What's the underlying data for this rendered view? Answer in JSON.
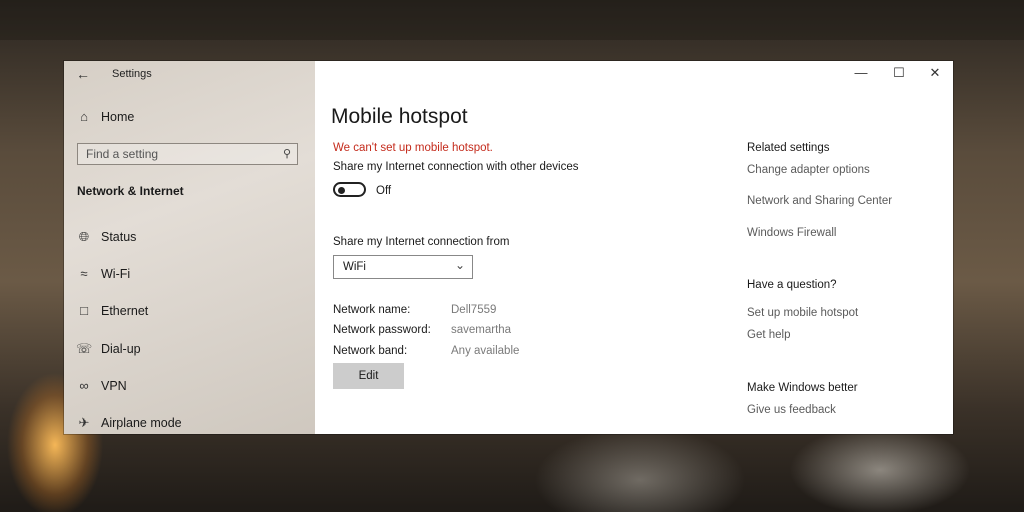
{
  "window": {
    "title": "Settings",
    "controls": {
      "minimize": "—",
      "maximize": "☐",
      "close": "✕"
    }
  },
  "sidebar": {
    "home_label": "Home",
    "search_placeholder": "Find a setting",
    "section_title": "Network & Internet",
    "items": [
      {
        "label": "Status",
        "icon": "globe-icon"
      },
      {
        "label": "Wi-Fi",
        "icon": "wifi-icon"
      },
      {
        "label": "Ethernet",
        "icon": "ethernet-icon"
      },
      {
        "label": "Dial-up",
        "icon": "phone-icon"
      },
      {
        "label": "VPN",
        "icon": "vpn-icon"
      },
      {
        "label": "Airplane mode",
        "icon": "airplane-icon"
      }
    ]
  },
  "main": {
    "title": "Mobile hotspot",
    "error": "We can't set up mobile hotspot.",
    "share_label": "Share my Internet connection with other devices",
    "toggle_state": "Off",
    "share_from_label": "Share my Internet connection from",
    "share_from_value": "WiFi",
    "network": {
      "name_label": "Network name:",
      "name_value": "Dell7559",
      "password_label": "Network password:",
      "password_value": "savemartha",
      "band_label": "Network band:",
      "band_value": "Any available"
    },
    "edit_label": "Edit"
  },
  "related": {
    "heading": "Related settings",
    "links": [
      "Change adapter options",
      "Network and Sharing Center",
      "Windows Firewall"
    ],
    "question_heading": "Have a question?",
    "question_links": [
      "Set up mobile hotspot",
      "Get help"
    ],
    "feedback_heading": "Make Windows better",
    "feedback_link": "Give us feedback"
  },
  "colors": {
    "error": "#c42b1c",
    "accent": "#1a1a1a"
  }
}
